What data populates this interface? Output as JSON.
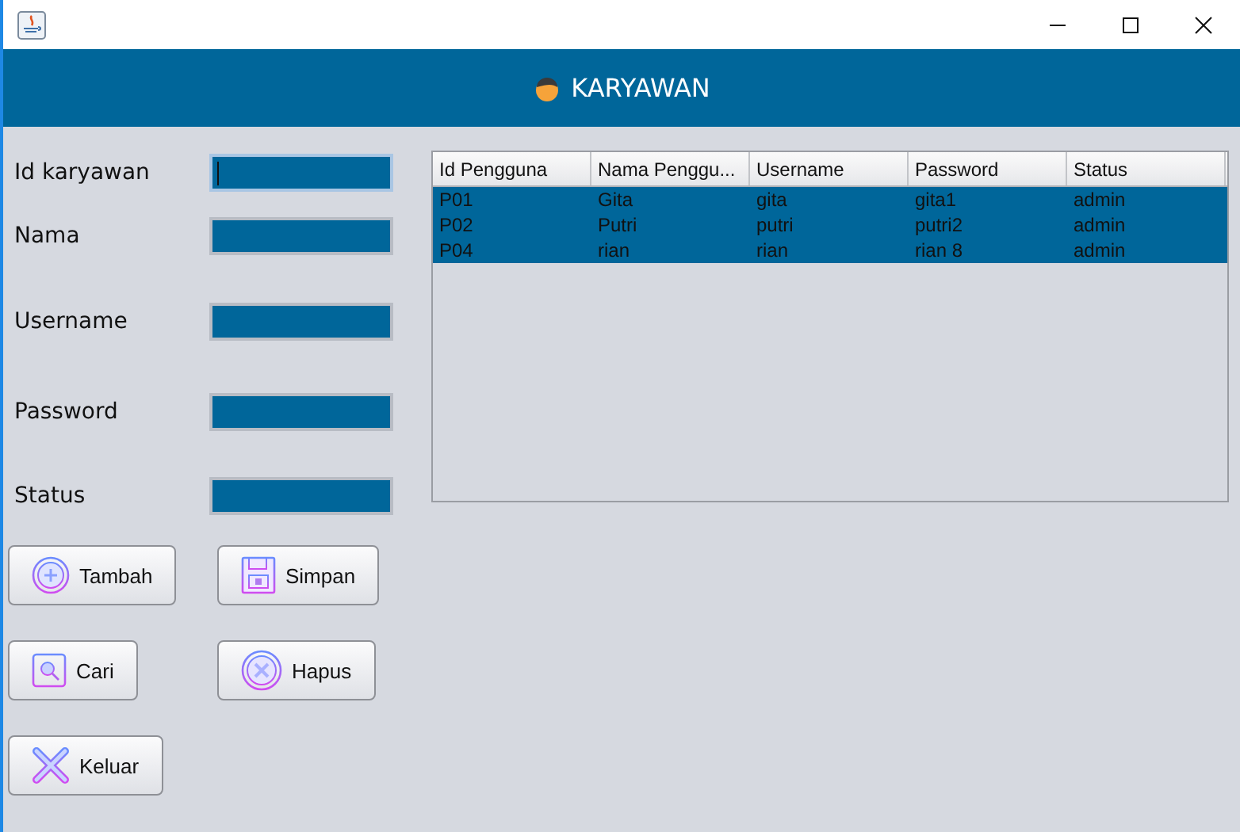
{
  "window": {
    "title": "KARYAWAN"
  },
  "fields": [
    {
      "label": "Id karyawan",
      "focused": true
    },
    {
      "label": "Nama",
      "focused": false
    },
    {
      "label": "Username",
      "focused": false
    },
    {
      "label": "Password",
      "focused": false
    },
    {
      "label": "Status",
      "focused": false
    }
  ],
  "buttons": [
    {
      "label": "Tambah"
    },
    {
      "label": "Simpan"
    },
    {
      "label": "Cari"
    },
    {
      "label": "Hapus"
    },
    {
      "label": "Keluar"
    }
  ],
  "table": {
    "columns": [
      "Id Pengguna",
      "Nama Penggu...",
      "Username",
      "Password",
      "Status"
    ],
    "rows": [
      {
        "cells": [
          "P01",
          "Gita",
          "gita",
          "gita1",
          "admin"
        ],
        "selected": true
      },
      {
        "cells": [
          "P02",
          "Putri",
          "putri",
          "putri2",
          "admin"
        ],
        "selected": true
      },
      {
        "cells": [
          "P04",
          "rian",
          "rian",
          "rian 8",
          "admin"
        ],
        "selected": true
      }
    ]
  }
}
